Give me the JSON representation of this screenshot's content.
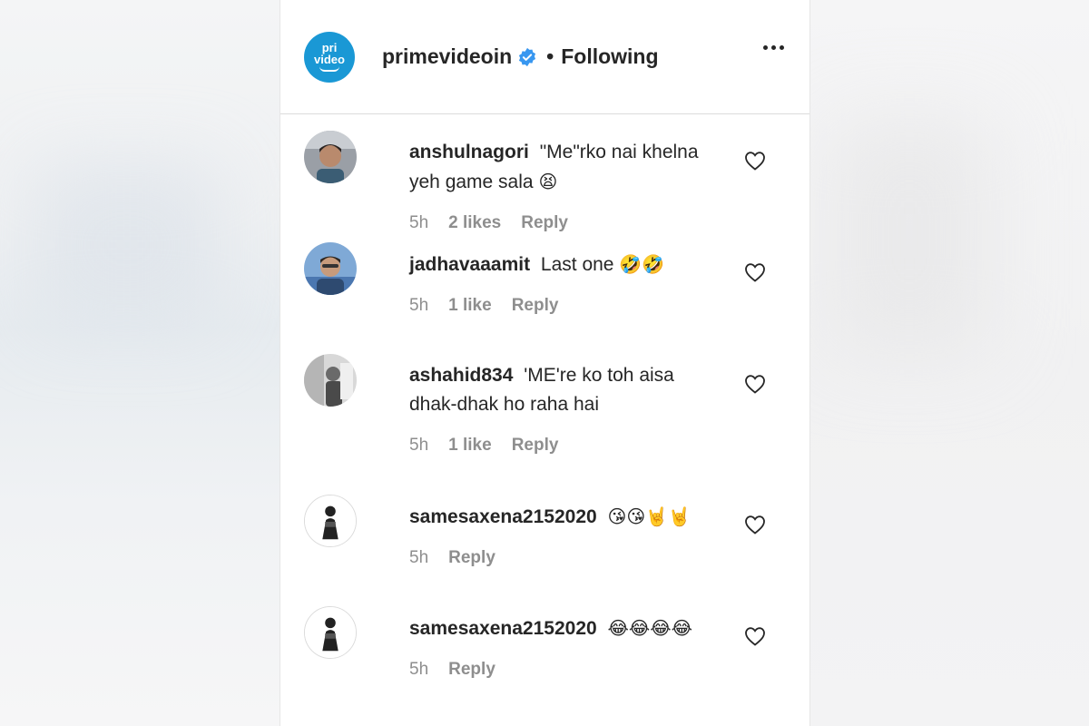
{
  "header": {
    "logo_top": "pri",
    "logo_bottom": "video",
    "username": "primevideoin",
    "separator": "•",
    "follow_state": "Following"
  },
  "comments": [
    {
      "username": "anshulnagori",
      "text": "\"Me\"rko nai khelna yeh game sala",
      "emoji": "😫",
      "time": "5h",
      "likes": "2 likes",
      "reply": "Reply"
    },
    {
      "username": "jadhavaaamit",
      "text": "Last one",
      "emoji": "🤣🤣",
      "time": "5h",
      "likes": "1 like",
      "reply": "Reply"
    },
    {
      "username": "ashahid834",
      "text": "'ME're ko toh aisa dhak-dhak ho raha hai",
      "emoji": "",
      "time": "5h",
      "likes": "1 like",
      "reply": "Reply"
    },
    {
      "username": "samesaxena2152020",
      "text": "",
      "emoji": "😘😘🤘🤘",
      "time": "5h",
      "likes": "",
      "reply": "Reply"
    },
    {
      "username": "samesaxena2152020",
      "text": "",
      "emoji": "😂😂😂😂",
      "time": "5h",
      "likes": "",
      "reply": "Reply"
    }
  ],
  "icons": {
    "verified": "verified-badge-icon",
    "more": "more-options-icon",
    "like": "heart-icon"
  },
  "colors": {
    "logo": "#1a98d5",
    "verified": "#3897f0",
    "muted": "#8e8e8e",
    "text": "#262626"
  }
}
